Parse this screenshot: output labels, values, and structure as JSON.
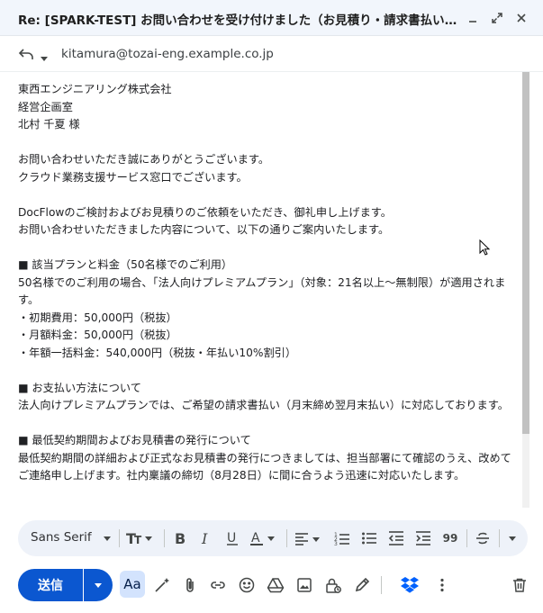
{
  "window": {
    "title": "Re: [SPARK-TEST] お問い合わせを受け付けました（お見積り・請求書払いについて）"
  },
  "recipient": "kitamura@tozai-eng.example.co.jp",
  "body_lines": [
    "東西エンジニアリング株式会社",
    "経営企画室",
    "北村 千夏 様",
    "",
    "お問い合わせいただき誠にありがとうございます。",
    "クラウド業務支援サービス窓口でございます。",
    "",
    "DocFlowのご検討およびお見積りのご依頼をいただき、御礼申し上げます。",
    "お問い合わせいただきました内容について、以下の通りご案内いたします。",
    "",
    "■ 該当プランと料金（50名様でのご利用）",
    "50名様でのご利用の場合、「法人向けプレミアムプラン」（対象：21名以上〜無制限）が適用されます。",
    "・初期費用：50,000円（税抜）",
    "・月額料金：50,000円（税抜）",
    "・年額一括料金：540,000円（税抜・年払い10%割引）",
    "",
    "■ お支払い方法について",
    "法人向けプレミアムプランでは、ご希望の請求書払い（月末締め翌月末払い）に対応しております。",
    "",
    "■ 最低契約期間およびお見積書の発行について",
    "最低契約期間の詳細および正式なお見積書の発行につきましては、担当部署にて確認のうえ、改めてご連絡申し上げます。社内稟議の締切（8月28日）に間に合うよう迅速に対応いたします。"
  ],
  "toolbar": {
    "font": "Sans Serif",
    "quote_label": "99"
  },
  "actions": {
    "send_label": "送信",
    "format_label": "Aa"
  },
  "colors": {
    "primary": "#0b57d0",
    "dropbox": "#0061fe"
  }
}
